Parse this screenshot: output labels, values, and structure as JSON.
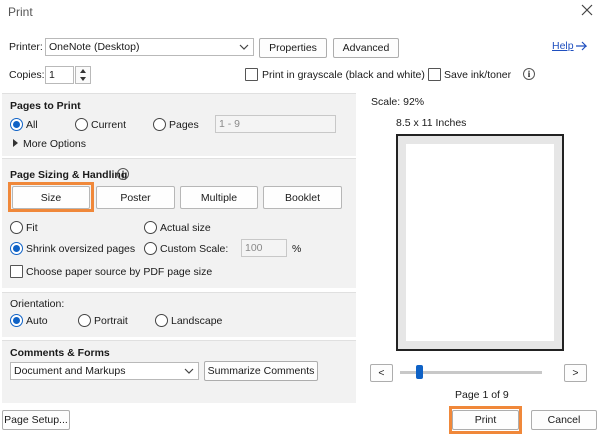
{
  "dialog": {
    "title": "Print",
    "help_link": "Help"
  },
  "printer": {
    "label": "Printer:",
    "selected": "OneNote (Desktop)",
    "properties_button": "Properties",
    "advanced_button": "Advanced"
  },
  "copies": {
    "label": "Copies:",
    "value": "1"
  },
  "options": {
    "grayscale_label": "Print in grayscale (black and white)",
    "grayscale_checked": false,
    "save_ink_label": "Save ink/toner",
    "save_ink_checked": false
  },
  "pages_to_print": {
    "title": "Pages to Print",
    "all_label": "All",
    "current_label": "Current",
    "pages_label": "Pages",
    "pages_value": "1 - 9",
    "selected": "All",
    "more_options_label": "More Options"
  },
  "page_sizing": {
    "title": "Page Sizing & Handling",
    "tabs": [
      {
        "label": "Size",
        "selected": true
      },
      {
        "label": "Poster",
        "selected": false
      },
      {
        "label": "Multiple",
        "selected": false
      },
      {
        "label": "Booklet",
        "selected": false
      }
    ],
    "fit_label": "Fit",
    "actual_size_label": "Actual size",
    "shrink_label": "Shrink oversized pages",
    "custom_scale_label": "Custom Scale:",
    "custom_scale_value": "100",
    "percent_sign": "%",
    "selected": "Shrink oversized pages",
    "paper_source_label": "Choose paper source by PDF page size",
    "paper_source_checked": false
  },
  "orientation": {
    "title": "Orientation:",
    "auto_label": "Auto",
    "portrait_label": "Portrait",
    "landscape_label": "Landscape",
    "selected": "Auto"
  },
  "comments_forms": {
    "title": "Comments & Forms",
    "selected": "Document and Markups",
    "summarize_button": "Summarize Comments"
  },
  "preview": {
    "scale_text": "Scale:  92%",
    "paper_size": "8.5 x 11 Inches",
    "page_indicator": "Page 1 of 9",
    "slider_position": 0,
    "prev_label": "<",
    "next_label": ">"
  },
  "footer": {
    "page_setup_button": "Page Setup...",
    "print_button": "Print",
    "cancel_button": "Cancel"
  },
  "colors": {
    "accent": "#0f62c6",
    "highlight": "#f0883a",
    "panel_bg": "#f2f2f2",
    "link": "#1f4fbf"
  }
}
